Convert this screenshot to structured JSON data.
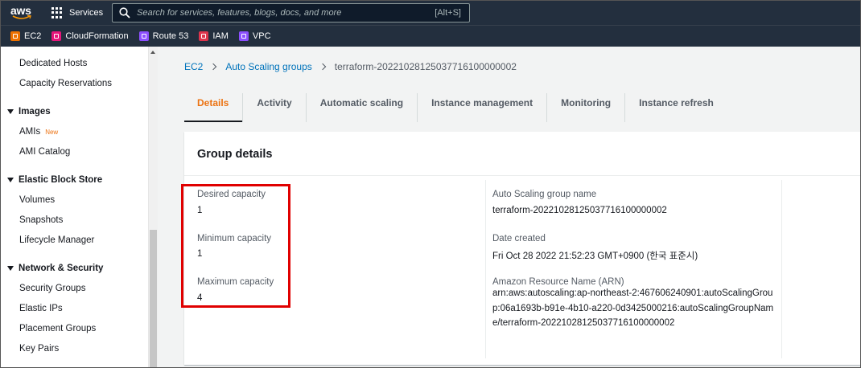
{
  "topbar": {
    "logo": "aws",
    "services_label": "Services",
    "search_placeholder": "Search for services, features, blogs, docs, and more",
    "search_shortcut": "[Alt+S]"
  },
  "favorites": [
    {
      "label": "EC2",
      "color": "#ed7100"
    },
    {
      "label": "CloudFormation",
      "color": "#e7157b"
    },
    {
      "label": "Route 53",
      "color": "#8c4fff"
    },
    {
      "label": "IAM",
      "color": "#dd344c"
    },
    {
      "label": "VPC",
      "color": "#8c4fff"
    }
  ],
  "sidebar": {
    "items_top": [
      "Dedicated Hosts",
      "Capacity Reservations"
    ],
    "images_section": "Images",
    "images_items": [
      "AMIs",
      "AMI Catalog"
    ],
    "new_badge": "New",
    "ebs_section": "Elastic Block Store",
    "ebs_items": [
      "Volumes",
      "Snapshots",
      "Lifecycle Manager"
    ],
    "netsec_section": "Network & Security",
    "netsec_items": [
      "Security Groups",
      "Elastic IPs",
      "Placement Groups",
      "Key Pairs"
    ]
  },
  "breadcrumb": {
    "items": [
      "EC2",
      "Auto Scaling groups",
      "terraform-20221028125037716100000002"
    ]
  },
  "tabs": [
    "Details",
    "Activity",
    "Automatic scaling",
    "Instance management",
    "Monitoring",
    "Instance refresh"
  ],
  "panel": {
    "title": "Group details",
    "desired_label": "Desired capacity",
    "desired_value": "1",
    "min_label": "Minimum capacity",
    "min_value": "1",
    "max_label": "Maximum capacity",
    "max_value": "4",
    "asg_name_label": "Auto Scaling group name",
    "asg_name_value": "terraform-20221028125037716100000002",
    "date_label": "Date created",
    "date_value": "Fri Oct 28 2022 21:52:23 GMT+0900 (한국 표준시)",
    "arn_label": "Amazon Resource Name (ARN)",
    "arn_value": "arn:aws:autoscaling:ap-northeast-2:467606240901:autoScalingGroup:06a1693b-b91e-4b10-a220-0d3425000216:autoScalingGroupName/terraform-20221028125037716100000002"
  },
  "colors": {
    "nav_bg": "#232f3e",
    "accent_orange": "#ec7211",
    "link_blue": "#0073bb",
    "highlight_red": "#e00000"
  }
}
